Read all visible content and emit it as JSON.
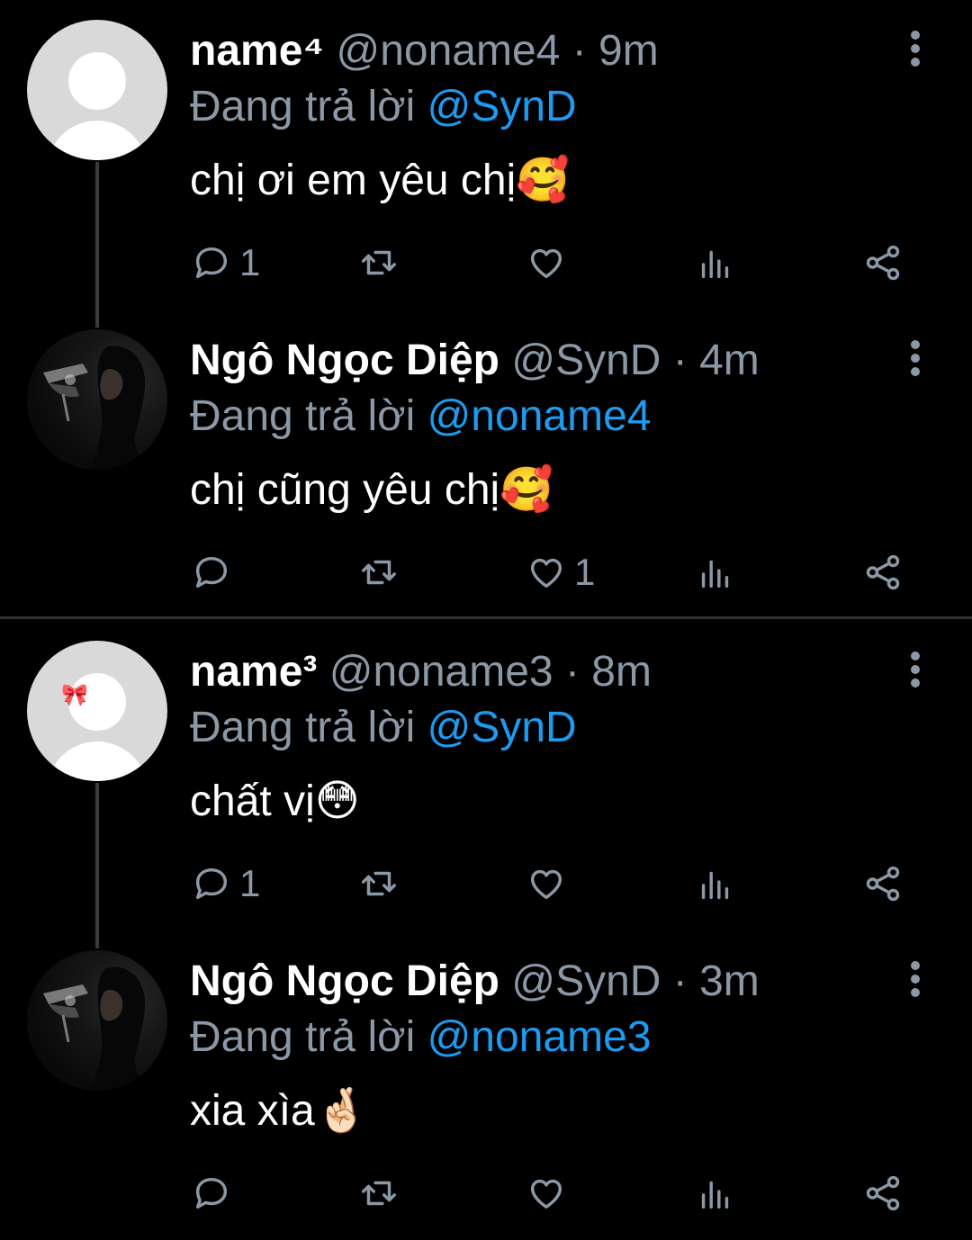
{
  "tweets": [
    {
      "name": "name⁴",
      "handle": "@noname4",
      "sep": " · ",
      "time": "9m",
      "reply_prefix": "Đang trả lời ",
      "reply_to": "@SynD",
      "text": "chị ơi em yêu chị",
      "emoji": "🥰",
      "avatar": "default-avatar",
      "reply_count": "1",
      "like_count": ""
    },
    {
      "name": "Ngô Ngọc Diệp",
      "handle": "@SynD",
      "sep": " · ",
      "time": "4m",
      "reply_prefix": "Đang trả lời ",
      "reply_to": "@noname4",
      "text": "chị cũng yêu chị",
      "emoji": "🥰",
      "avatar": "photo-avatar",
      "reply_count": "",
      "like_count": "1"
    },
    {
      "name": "name³",
      "handle": "@noname3",
      "sep": " · ",
      "time": "8m",
      "reply_prefix": "Đang trả lời ",
      "reply_to": "@SynD",
      "text": "chất vị",
      "emoji": "😳",
      "avatar": "default-avatar-bow",
      "bow_emoji": "🎀",
      "reply_count": "1",
      "like_count": ""
    },
    {
      "name": "Ngô Ngọc Diệp",
      "handle": "@SynD",
      "sep": " · ",
      "time": "3m",
      "reply_prefix": "Đang trả lời ",
      "reply_to": "@noname3",
      "text": "xia xìa",
      "emoji": "🤞🏻",
      "avatar": "photo-avatar",
      "reply_count": "",
      "like_count": ""
    }
  ],
  "icons": {
    "reply": "reply-icon",
    "retweet": "retweet-icon",
    "like": "heart-icon",
    "views": "views-icon",
    "share": "share-icon",
    "more": "more-vertical-icon"
  },
  "colors": {
    "background": "#000000",
    "text": "#ffffff",
    "secondary": "#8b98a5",
    "mention": "#1d9bf0",
    "divider": "#2f3336",
    "thread_line": "#3b3b3b"
  }
}
